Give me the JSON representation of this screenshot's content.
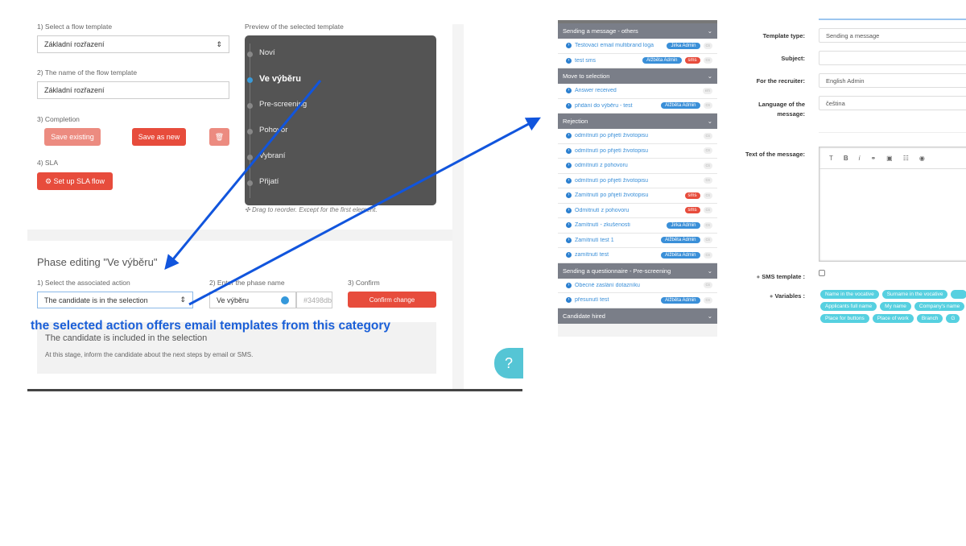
{
  "flow": {
    "step1_label": "1) Select a flow template",
    "step1_value": "Základní rozřazení",
    "step2_label": "2) The name of the flow template",
    "step2_value": "Základní rozřazení",
    "step3_label": "3) Completion",
    "save_existing": "Save existing",
    "save_new": "Save as new",
    "step4_label": "4) SLA",
    "sla_button": "Set up SLA flow"
  },
  "preview": {
    "title": "Preview of the selected template",
    "phases": [
      "Noví",
      "Ve výběru",
      "Pre-screening",
      "Pohovor",
      "Vybraní",
      "Přijatí"
    ],
    "active": "Ve výběru",
    "hint": "Drag to reorder. Except for the first element."
  },
  "phase_edit": {
    "title": "Phase editing \"Ve výběru\"",
    "action_label": "1) Select the associated action",
    "action_value": "The candidate is in the selection",
    "name_label": "2) Enter the phase name",
    "name_value": "Ve výběru",
    "color_value": "#3498db",
    "color_hex": "#3498db",
    "confirm_label": "3) Confirm",
    "confirm_button": "Confirm change",
    "info_title": "The candidate is included in the selection",
    "info_text": "At this stage, inform the candidate about the next steps by email or SMS."
  },
  "annotation": "the selected action offers email templates from this category",
  "help": "?",
  "templates": [
    {
      "category": "Sending a message - others",
      "items": [
        {
          "name": "Testovací email multibrand loga",
          "owner": "Jirka Admin",
          "sms": false,
          "lang": "cs"
        },
        {
          "name": "test sms",
          "owner": "Alžběta Admin",
          "sms": true,
          "lang": "cs"
        }
      ]
    },
    {
      "category": "Move to selection",
      "items": [
        {
          "name": "Answer received",
          "owner": "",
          "sms": false,
          "lang": "en"
        },
        {
          "name": "přidání do výběru - test",
          "owner": "Alžběta Admin",
          "sms": false,
          "lang": "cs"
        }
      ]
    },
    {
      "category": "Rejection",
      "items": [
        {
          "name": "odmítnutí po přijetí životopisu",
          "owner": "",
          "sms": false,
          "lang": "cs"
        },
        {
          "name": "odmítnutí po přijetí životopisu",
          "owner": "",
          "sms": false,
          "lang": "cs"
        },
        {
          "name": "odmítnutí z pohovoru",
          "owner": "",
          "sms": false,
          "lang": "cs"
        },
        {
          "name": "odmítnutí po přijetí životopisu",
          "owner": "",
          "sms": false,
          "lang": "cs"
        },
        {
          "name": "Zamítnutí po přijetí životopisu",
          "owner": "",
          "sms": true,
          "lang": "cs"
        },
        {
          "name": "Odmítnutí z pohovoru",
          "owner": "",
          "sms": true,
          "lang": "cs"
        },
        {
          "name": "Zamítnutí - zkušenosti",
          "owner": "Jirka Admin",
          "sms": false,
          "lang": "cs"
        },
        {
          "name": "Zamítnutí test 1",
          "owner": "Alžběta Admin",
          "sms": false,
          "lang": "cs"
        },
        {
          "name": "zamítnutí test",
          "owner": "Alžběta Admin",
          "sms": false,
          "lang": "cs"
        }
      ]
    },
    {
      "category": "Sending a questionnaire - Pre-screening",
      "items": [
        {
          "name": "Obecné zaslání dotazníku",
          "owner": "",
          "sms": false,
          "lang": "cs"
        },
        {
          "name": "přesunutí test",
          "owner": "Alžběta Admin",
          "sms": false,
          "lang": "cs"
        }
      ]
    },
    {
      "category": "Candidate hired",
      "items": []
    }
  ],
  "sms_label": "sms",
  "form": {
    "type_label": "Template type:",
    "type_value": "Sending a message",
    "subject_label": "Subject:",
    "subject_value": "",
    "recruiter_label": "For the recruiter:",
    "recruiter_value": "English Admin",
    "lang_label": "Language of the message:",
    "lang_value": "čeština",
    "text_label": "Text of the message:",
    "toolbar": [
      "T",
      "B",
      "i",
      "link-icon",
      "image-icon",
      "table-icon",
      "eye-icon"
    ],
    "sms_template_label": "SMS template :",
    "variables_label": "Variables :",
    "variables": [
      "Name in the vocative",
      "Surname in the vocative",
      "",
      "Applicants full name",
      "My name",
      "Company's name",
      "Place for buttons",
      "Place of work",
      "Branch",
      "G"
    ]
  }
}
